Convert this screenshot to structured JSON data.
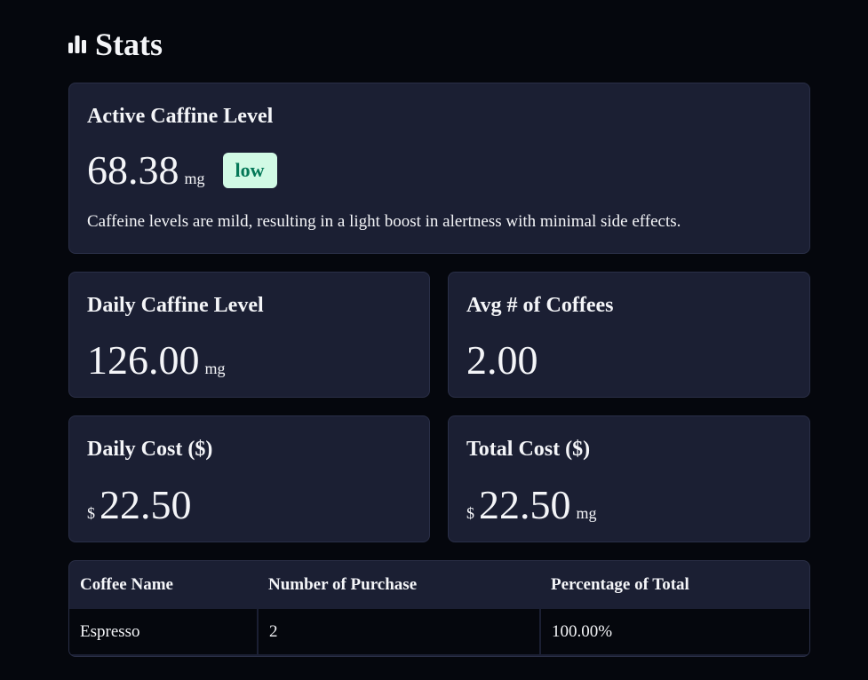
{
  "header": {
    "title": "Stats",
    "icon": "bar-chart-icon"
  },
  "active": {
    "title": "Active Caffine Level",
    "value": "68.38",
    "unit": "mg",
    "badge": "low",
    "badge_color": "#047857",
    "badge_bg": "#d1fae5",
    "description": "Caffeine levels are mild, resulting in a light boost in alertness with minimal side effects."
  },
  "daily_caffeine": {
    "title": "Daily Caffine Level",
    "value": "126.00",
    "unit": "mg"
  },
  "avg_coffees": {
    "title": "Avg # of Coffees",
    "value": "2.00"
  },
  "daily_cost": {
    "title": "Daily Cost ($)",
    "prefix": "$",
    "value": "22.50"
  },
  "total_cost": {
    "title": "Total Cost ($)",
    "prefix": "$",
    "value": "22.50",
    "unit": "mg"
  },
  "table": {
    "headers": [
      "Coffee Name",
      "Number of Purchase",
      "Percentage of Total"
    ],
    "rows": [
      [
        "Espresso",
        "2",
        "100.00%"
      ]
    ]
  },
  "colors": {
    "background": "#05070d",
    "card": "#1b1f33",
    "text": "#f4f5f8"
  }
}
